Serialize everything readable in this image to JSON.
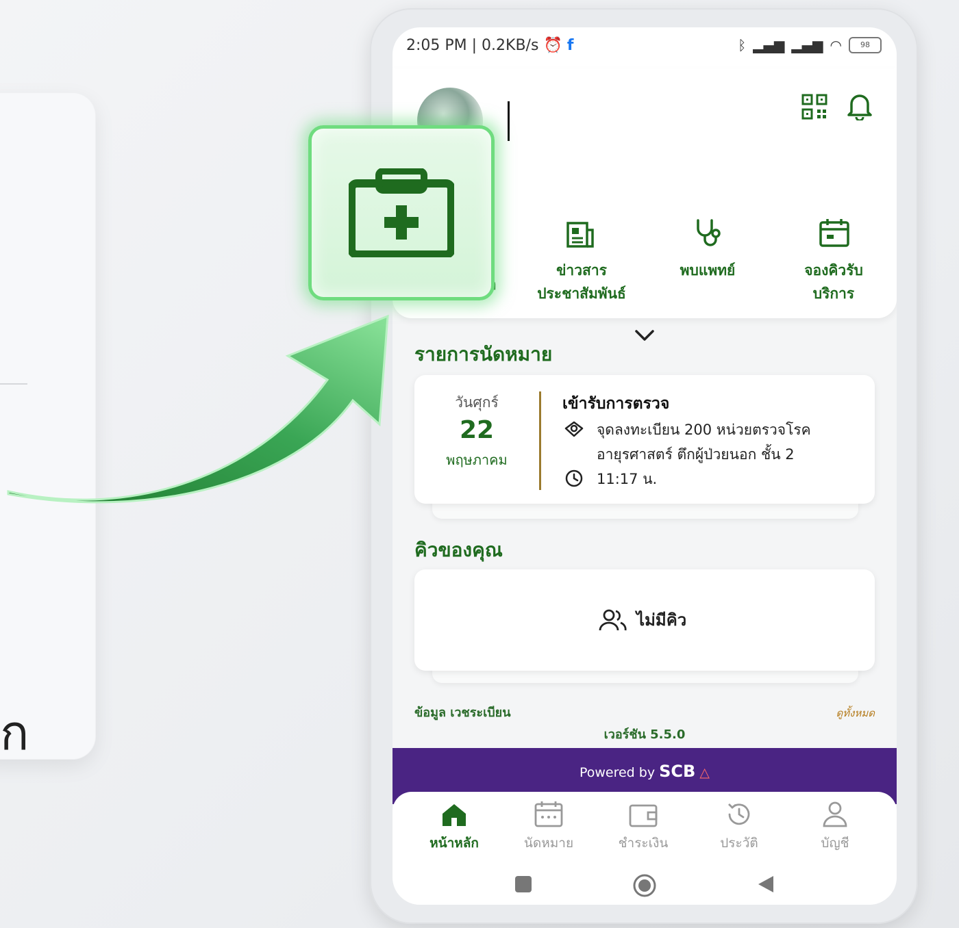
{
  "background_card": {
    "partial_glyph": "ก"
  },
  "status_bar": {
    "time_text": "2:05 PM | 0.2KB/s",
    "battery": "98"
  },
  "menu": {
    "partial_label": "า",
    "items": [
      {
        "label_line1": "ข่าวสาร",
        "label_line2": "ประชาสัมพันธ์",
        "icon": "news-icon"
      },
      {
        "label_line1": "พบแพทย์",
        "label_line2": "",
        "icon": "stethoscope-icon"
      },
      {
        "label_line1": "จองคิวรับ",
        "label_line2": "บริการ",
        "icon": "calendar-icon"
      }
    ]
  },
  "appointments": {
    "section_title": "รายการนัดหมาย",
    "day": "วันศุกร์",
    "date": "22",
    "month": "พฤษภาคม",
    "title": "เข้ารับการตรวจ",
    "location_line1": "จุดลงทะเบียน 200 หน่วยตรวจโรค",
    "location_line2": "อายุรศาสตร์ ตึกผู้ป่วยนอก ชั้น 2",
    "time": "11:17 น."
  },
  "queue": {
    "section_title": "คิวของคุณ",
    "empty_text": "ไม่มีคิว"
  },
  "footer": {
    "left_text": "ข้อมูล เวชระเบียน",
    "right_text": "ดูทั้งหมด",
    "version": "เวอร์ชัน 5.5.0"
  },
  "powered": {
    "prefix": "Powered by",
    "brand": "SCB"
  },
  "bottom_nav": {
    "items": [
      {
        "label": "หน้าหลัก",
        "icon": "home-icon",
        "active": true
      },
      {
        "label": "นัดหมาย",
        "icon": "calendar-icon",
        "active": false
      },
      {
        "label": "ชำระเงิน",
        "icon": "wallet-icon",
        "active": false
      },
      {
        "label": "ประวัติ",
        "icon": "history-icon",
        "active": false
      },
      {
        "label": "บัญชี",
        "icon": "user-icon",
        "active": false
      }
    ]
  },
  "colors": {
    "primary": "#1f6b1f",
    "scb_purple": "#4a2483",
    "highlight": "#6fdc7f"
  }
}
